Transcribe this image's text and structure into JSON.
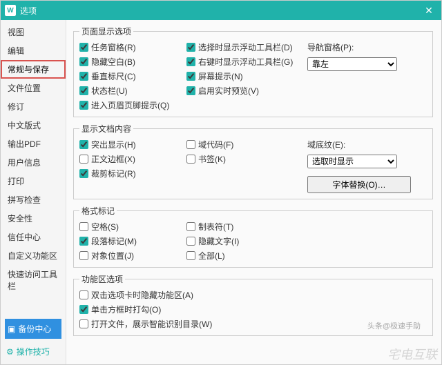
{
  "window": {
    "title": "选项"
  },
  "sidebar": {
    "items": [
      "视图",
      "编辑",
      "常规与保存",
      "文件位置",
      "修订",
      "中文版式",
      "输出PDF",
      "用户信息",
      "打印",
      "拼写检查",
      "安全性",
      "信任中心",
      "自定义功能区",
      "快速访问工具栏"
    ],
    "backup": "备份中心",
    "tips": "操作技巧"
  },
  "groups": {
    "page": {
      "title": "页面显示选项",
      "col1": [
        "任务窗格(R)",
        "隐藏空白(B)",
        "垂直标尺(C)",
        "状态栏(U)",
        "进入页眉页脚提示(Q)"
      ],
      "col2": [
        "选择时显示浮动工具栏(D)",
        "右键时显示浮动工具栏(G)",
        "屏幕提示(N)",
        "启用实时预览(V)"
      ],
      "nav_label": "导航窗格(P):",
      "nav_value": "靠左"
    },
    "doc": {
      "title": "显示文档内容",
      "col1": [
        "突出显示(H)",
        "正文边框(X)",
        "裁剪标记(R)"
      ],
      "col2": [
        "域代码(F)",
        "书签(K)"
      ],
      "shade_label": "域底纹(E):",
      "shade_value": "选取时显示",
      "font_btn": "字体替换(O)…"
    },
    "fmt": {
      "title": "格式标记",
      "col1": [
        "空格(S)",
        "段落标记(M)",
        "对象位置(J)"
      ],
      "col2": [
        "制表符(T)",
        "隐藏文字(I)",
        "全部(L)"
      ]
    },
    "ribbon": {
      "title": "功能区选项",
      "items": [
        "双击选项卡时隐藏功能区(A)",
        "单击方框时打勾(O)",
        "打开文件，展示智能识别目录(W)"
      ]
    }
  },
  "watermark": {
    "main": "宅电互联",
    "sub": "头条@极速手助"
  }
}
